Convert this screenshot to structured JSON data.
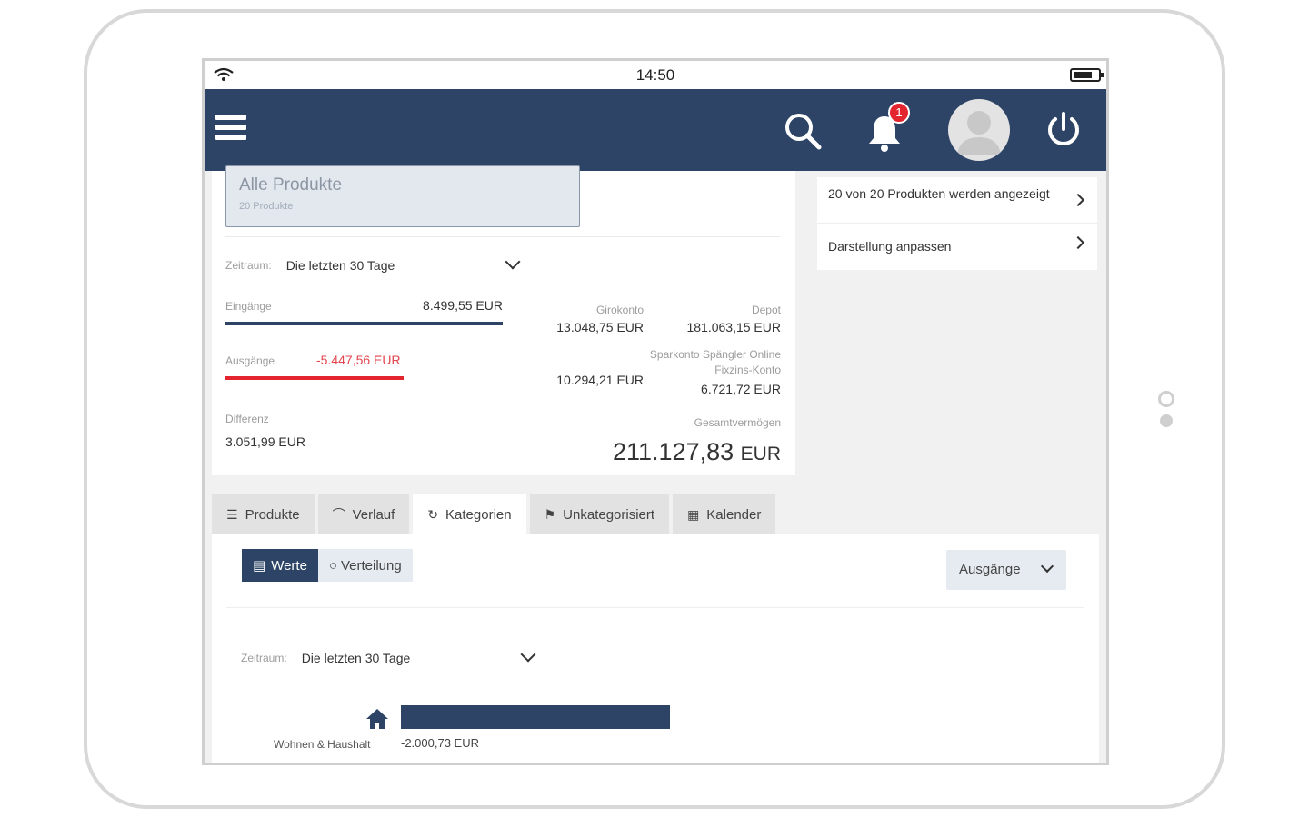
{
  "status_bar": {
    "time": "14:50"
  },
  "header": {
    "notification_count": "1"
  },
  "product_filter": {
    "title": "Alle Produkte",
    "subtitle": "20 Produkte"
  },
  "summary": {
    "period_label": "Zeitraum:",
    "period_value": "Die letzten 30 Tage",
    "income_label": "Eingänge",
    "income_value": "8.499,55 EUR",
    "expense_label": "Ausgänge",
    "expense_value": "-5.447,56 EUR",
    "difference_label": "Differenz",
    "difference_value": "3.051,99 EUR",
    "accounts": [
      {
        "name": "Girokonto",
        "value": "13.048,75 EUR"
      },
      {
        "name": "Depot",
        "value": "181.063,15 EUR"
      },
      {
        "name": "Sparkonto Spängler Online Fixzins-Konto",
        "value": "6.721,72 EUR"
      },
      {
        "name": "",
        "value": "10.294,21 EUR"
      }
    ],
    "total_label": "Gesamtvermögen",
    "total_amount": "211.127,83",
    "total_currency": "EUR"
  },
  "right_panel": {
    "items": [
      {
        "label": "20 von 20 Produkten werden angezeigt"
      },
      {
        "label": "Darstellung anpassen"
      }
    ]
  },
  "tabs": [
    {
      "label": "Produkte",
      "icon": "list-icon"
    },
    {
      "label": "Verlauf",
      "icon": "trend-icon"
    },
    {
      "label": "Kategorien",
      "icon": "refresh-icon"
    },
    {
      "label": "Unkategorisiert",
      "icon": "flag-icon"
    },
    {
      "label": "Kalender",
      "icon": "calendar-icon"
    }
  ],
  "categories_view": {
    "toggle": {
      "values_label": "Werte",
      "distribution_label": "Verteilung"
    },
    "type_dropdown": "Ausgänge",
    "period_label": "Zeitraum:",
    "period_value": "Die letzten 30 Tage",
    "items": [
      {
        "name": "Wohnen & Haushalt",
        "amount": "-2.000,73 EUR",
        "icon": "home-icon"
      }
    ]
  },
  "colors": {
    "primary": "#2d4466",
    "expense": "#e2252e",
    "income": "#2d4466"
  }
}
